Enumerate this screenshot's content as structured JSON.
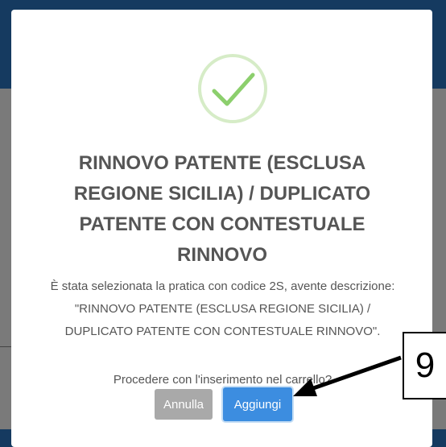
{
  "modal": {
    "title": "RINNOVO PATENTE (ESCLUSA REGIONE SICILIA) / DUPLICATO PATENTE CON CONTESTUALE RINNOVO",
    "message": "È stata selezionata la pratica con codice 2S, avente descrizione: \"RINNOVO PATENTE (ESCLUSA REGIONE SICILIA) / DUPLICATO PATENTE CON CONTESTUALE RINNOVO\".",
    "question": "Procedere con l'inserimento nel carrello?",
    "cancel_label": "Annulla",
    "confirm_label": "Aggiungi",
    "icon": "success-check-icon",
    "accent_color": "#3c8de0",
    "success_color": "#8ccf6d"
  },
  "annotation": {
    "step_number": "9"
  }
}
